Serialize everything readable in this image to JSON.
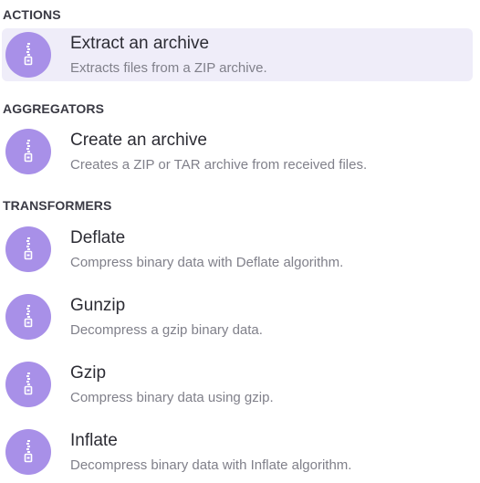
{
  "sections": [
    {
      "header": "ACTIONS",
      "items": [
        {
          "title": "Extract an archive",
          "description": "Extracts files from a ZIP archive.",
          "icon": "zip-archive-icon",
          "selected": true
        }
      ]
    },
    {
      "header": "AGGREGATORS",
      "items": [
        {
          "title": "Create an archive",
          "description": "Creates a ZIP or TAR archive from received files.",
          "icon": "zip-archive-icon",
          "selected": false
        }
      ]
    },
    {
      "header": "TRANSFORMERS",
      "items": [
        {
          "title": "Deflate",
          "description": "Compress binary data with Deflate algorithm.",
          "icon": "zip-archive-icon",
          "selected": false
        },
        {
          "title": "Gunzip",
          "description": "Decompress a gzip binary data.",
          "icon": "zip-archive-icon",
          "selected": false
        },
        {
          "title": "Gzip",
          "description": "Compress binary data using gzip.",
          "icon": "zip-archive-icon",
          "selected": false
        },
        {
          "title": "Inflate",
          "description": "Decompress binary data with Inflate algorithm.",
          "icon": "zip-archive-icon",
          "selected": false
        }
      ]
    }
  ],
  "colors": {
    "icon_background": "#a890e8",
    "selected_background": "#efedf9"
  }
}
